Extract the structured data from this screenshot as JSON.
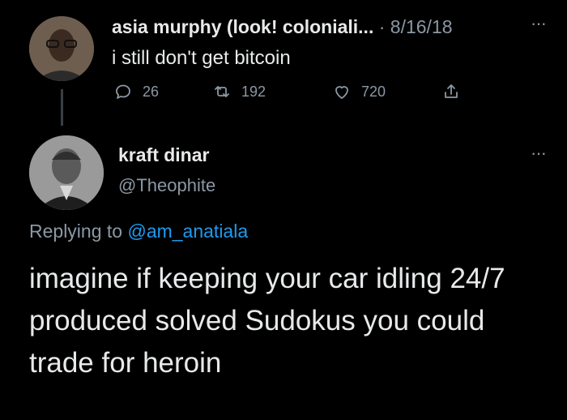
{
  "tweet1": {
    "author_name": "asia murphy (look! coloniali...",
    "separator": "·",
    "date": "8/16/18",
    "more_label": "···",
    "text": "i still don't get bitcoin",
    "reply_count": "26",
    "retweet_count": "192",
    "like_count": "720"
  },
  "tweet2": {
    "author_name": "kraft dinar",
    "handle": "@Theophite",
    "more_label": "···",
    "replying_prefix": "Replying to ",
    "replying_mention": "@am_anatiala",
    "body": "imagine if keeping your car idling 24/7\nproduced solved Sudokus you could\ntrade for heroin"
  },
  "icons": {
    "reply": "speech-bubble-icon",
    "retweet": "retweet-icon",
    "like": "heart-icon",
    "share": "share-icon"
  },
  "colors": {
    "background": "#000000",
    "primary_text": "#e7e9ea",
    "secondary_text": "#8b98a5",
    "link": "#1d9bf0"
  }
}
